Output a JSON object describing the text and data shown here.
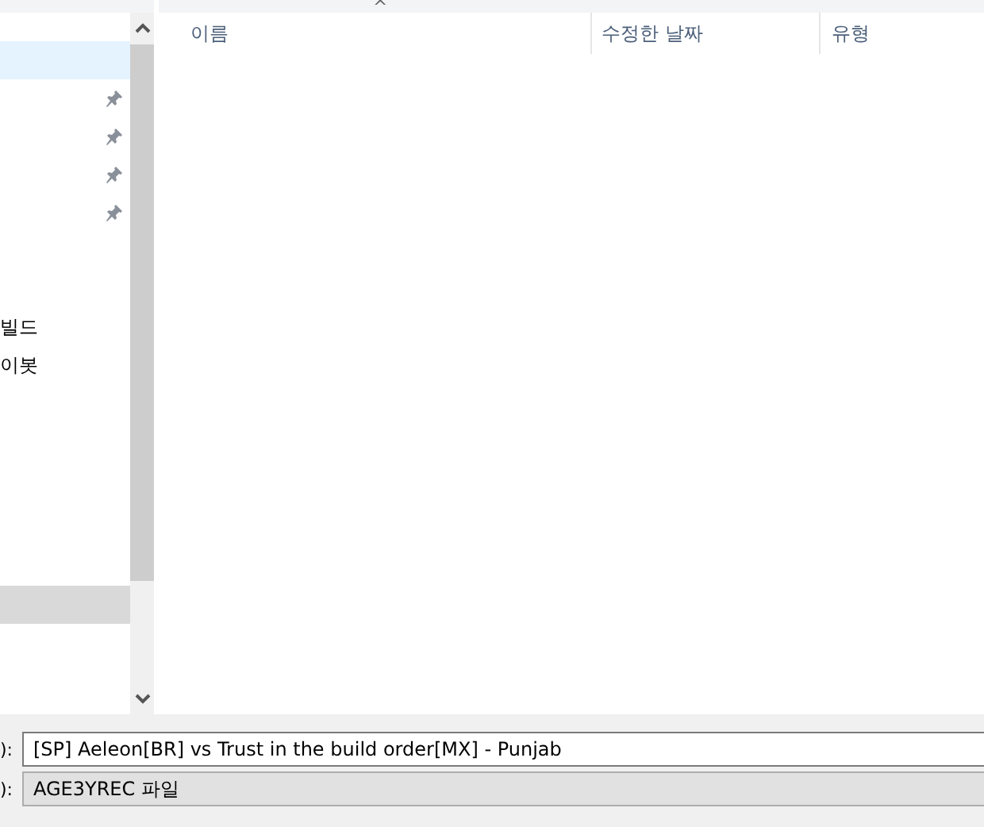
{
  "sidebar": {
    "items": [
      {
        "selected": true,
        "pinned": false
      },
      {
        "selected": false,
        "pinned": true
      },
      {
        "selected": false,
        "pinned": true
      },
      {
        "selected": false,
        "pinned": true
      },
      {
        "selected": false,
        "pinned": true
      },
      {
        "selected": false,
        "pinned": false
      },
      {
        "selected": false,
        "pinned": false
      },
      {
        "selected": false,
        "pinned": false,
        "label": "빌드"
      },
      {
        "selected": false,
        "pinned": false,
        "label": "이봇"
      }
    ],
    "lower_items": [
      {
        "hovered": true
      }
    ]
  },
  "file_list": {
    "columns": [
      {
        "label": "이름"
      },
      {
        "label": "수정한 날짜"
      },
      {
        "label": "유형"
      }
    ],
    "sort_indicator": "^"
  },
  "file_name": {
    "label": "):",
    "value": "[SP] Aeleon[BR] vs Trust in the build order[MX] - Punjab"
  },
  "file_type": {
    "label": "):",
    "value": "AGE3YREC 파일"
  }
}
